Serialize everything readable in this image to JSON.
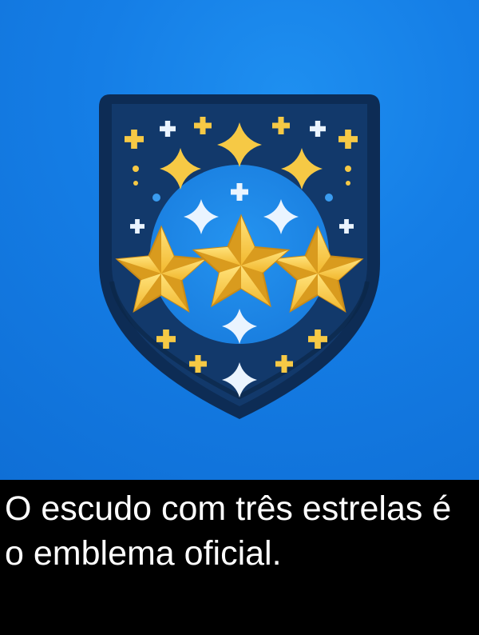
{
  "illustration": {
    "subject": "shield-with-three-stars",
    "colors": {
      "background": "#157ee6",
      "shield_fill": "#12396b",
      "shield_border": "#0d2c55",
      "inner_circle": "#1a86e6",
      "star_gold": "#f5c542",
      "star_gold_dark": "#d99b1e",
      "sparkle_white": "#eaf4ff",
      "sparkle_gold": "#f6c945"
    },
    "big_star_count": 3
  },
  "caption": {
    "text": "O escudo com três estrelas é o emblema oficial."
  }
}
